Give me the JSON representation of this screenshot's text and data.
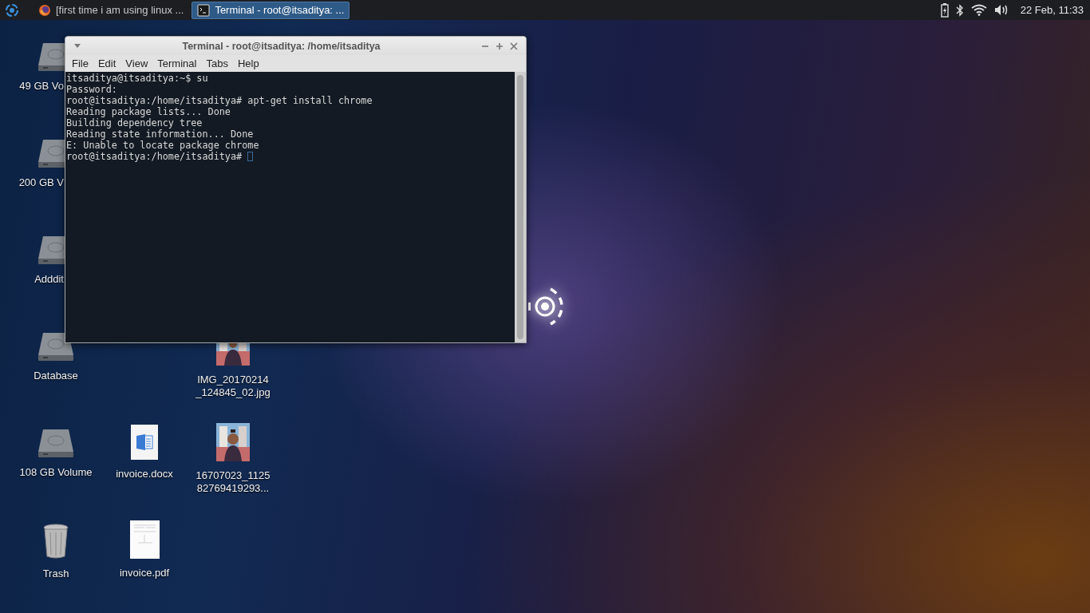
{
  "taskbar": {
    "tasks": [
      {
        "title": "[first time i am using linux ...",
        "selected": false,
        "kind": "browser"
      },
      {
        "title": "Terminal - root@itsaditya: ...",
        "selected": true,
        "kind": "terminal"
      }
    ],
    "clock": "22 Feb, 11:33"
  },
  "desktop_icons": [
    {
      "label": "49 GB Vo",
      "kind": "drive"
    },
    {
      "label": "200 GB V",
      "kind": "drive"
    },
    {
      "label": "Adddit",
      "kind": "drive"
    },
    {
      "label": "Database",
      "kind": "drive"
    },
    {
      "label": "IMG_20170214\n_124845_02.jpg"
    },
    {
      "label": "108 GB Volume",
      "kind": "drive"
    },
    {
      "label": "invoice.docx",
      "kind": "document"
    },
    {
      "label": "16707023_1125\n82769419293..."
    },
    {
      "label": "Trash",
      "kind": "trash"
    },
    {
      "label": "invoice.pdf",
      "kind": "pdf"
    }
  ],
  "terminal": {
    "title": "Terminal - root@itsaditya: /home/itsaditya",
    "menu": [
      "File",
      "Edit",
      "View",
      "Terminal",
      "Tabs",
      "Help"
    ],
    "lines": [
      "itsaditya@itsaditya:~$ su",
      "Password:",
      "root@itsaditya:/home/itsaditya# apt-get install chrome",
      "Reading package lists... Done",
      "Building dependency tree",
      "Reading state information... Done",
      "E: Unable to locate package chrome",
      "root@itsaditya:/home/itsaditya# "
    ],
    "cursor_visible": true
  }
}
